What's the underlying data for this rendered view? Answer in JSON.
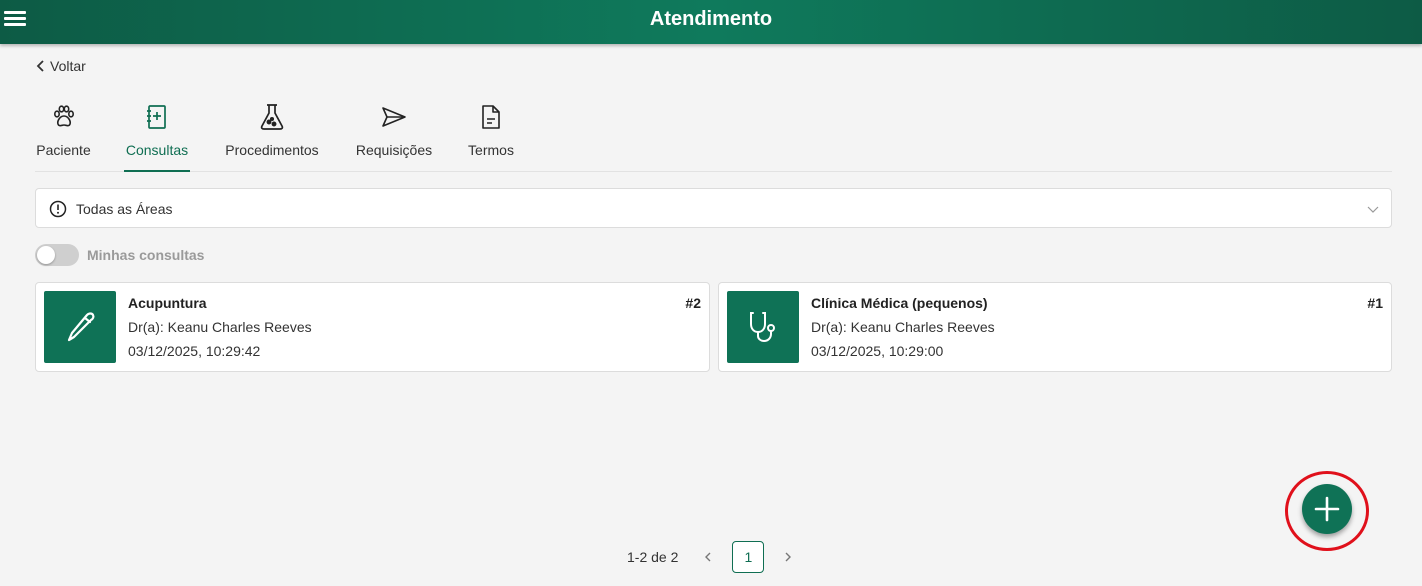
{
  "header": {
    "title": "Atendimento",
    "menu_icon": "hamburger-icon"
  },
  "back": {
    "label": "Voltar"
  },
  "tabs": [
    {
      "label": "Paciente",
      "icon": "paw-icon",
      "active": false
    },
    {
      "label": "Consultas",
      "icon": "medical-notebook-icon",
      "active": true
    },
    {
      "label": "Procedimentos",
      "icon": "flask-icon",
      "active": false
    },
    {
      "label": "Requisições",
      "icon": "send-icon",
      "active": false
    },
    {
      "label": "Termos",
      "icon": "document-icon",
      "active": false
    }
  ],
  "area_filter": {
    "value": "Todas as Áreas"
  },
  "my_consultations": {
    "label": "Minhas consultas",
    "checked": false
  },
  "consultations": [
    {
      "area": "Acupuntura",
      "doctor": "Dr(a): Keanu Charles Reeves",
      "datetime": "03/12/2025, 10:29:42",
      "number": "#2",
      "icon": "needle-icon"
    },
    {
      "area": "Clínica Médica (pequenos)",
      "doctor": "Dr(a): Keanu Charles Reeves",
      "datetime": "03/12/2025, 10:29:00",
      "number": "#1",
      "icon": "stethoscope-icon"
    }
  ],
  "pagination": {
    "range": "1-2 de 2",
    "current_page": "1"
  },
  "colors": {
    "primary": "#0f7256",
    "highlight_ring": "#e0101b"
  }
}
